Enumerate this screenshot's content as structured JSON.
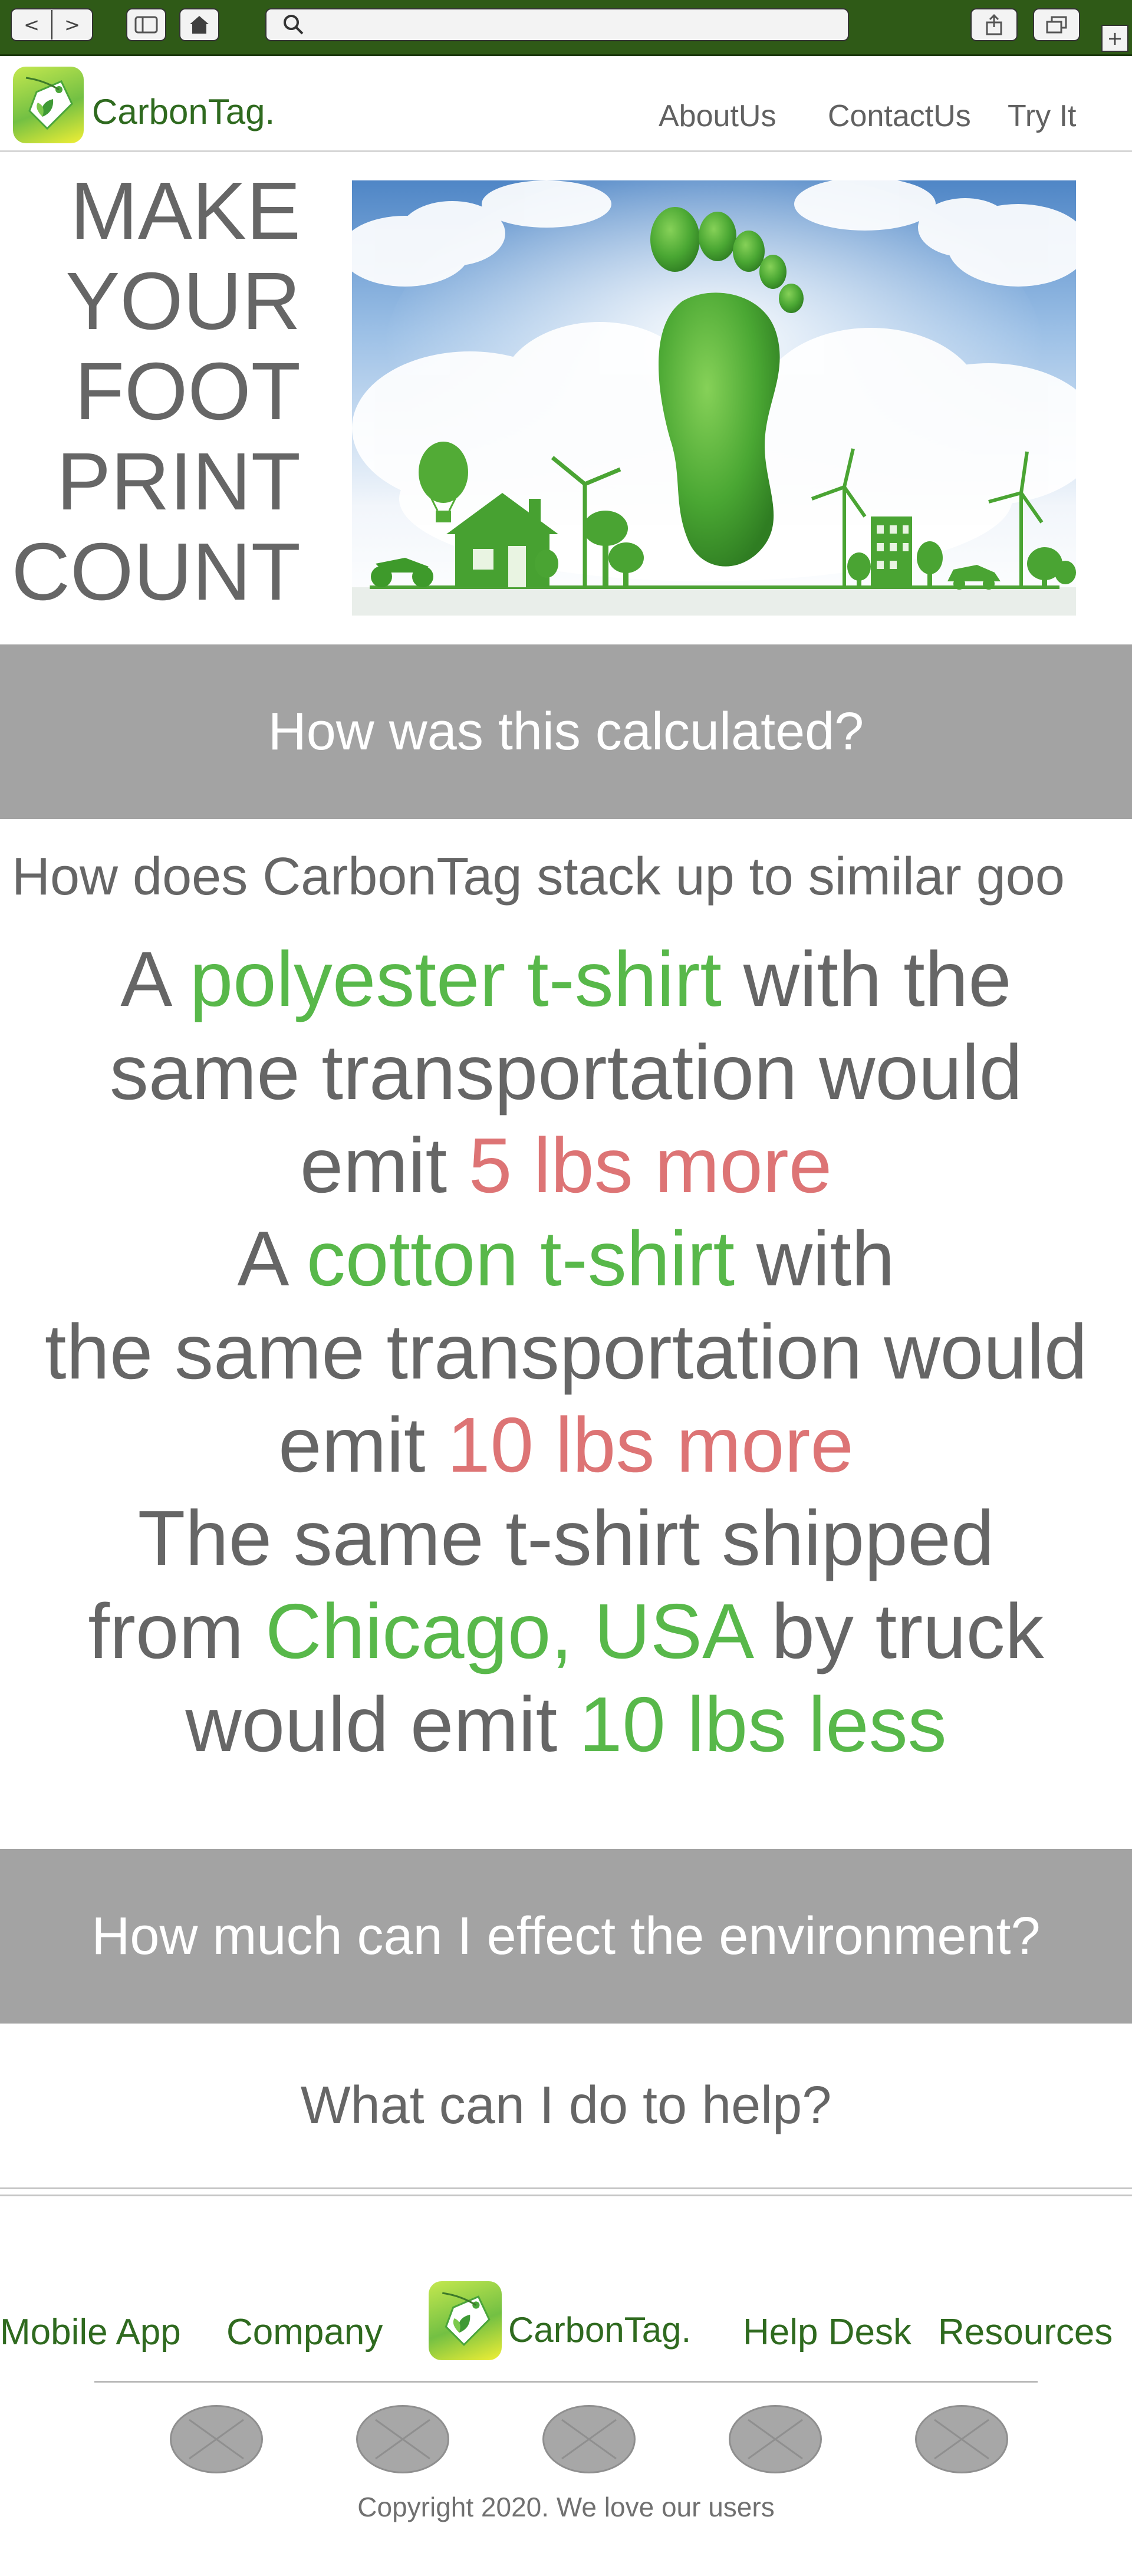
{
  "browser": {
    "back_icon": "chevron-left-icon",
    "forward_icon": "chevron-right-icon",
    "back_glyph": "<",
    "forward_glyph": ">",
    "address_placeholder": "",
    "new_tab_glyph": "+",
    "icons": [
      "sidebar-icon",
      "home-icon",
      "search-icon",
      "share-icon",
      "tabs-icon",
      "plus-icon"
    ]
  },
  "header": {
    "brand": "CarbonTag.",
    "nav": [
      "AboutUs",
      "ContactUs",
      "Try It"
    ]
  },
  "hero": {
    "words": [
      "MAKE",
      "YOUR",
      "FOOT",
      "PRINT",
      "COUNT"
    ],
    "image": "green grass footprint among clouds with wind turbines, house, trees, car, hot-air balloon"
  },
  "sections": {
    "calc_banner": "How was this calculated?",
    "compare_heading": "How does CarbonTag stack up to similar goo",
    "effect_banner": "How much can I effect the environment?",
    "help_heading": "What can I do to help?"
  },
  "comparisons": {
    "c1": {
      "p1": "A ",
      "item": "polyester t-shirt",
      "p2": " with the",
      "l2": "same transportation would",
      "p3": "emit ",
      "amount": "5 lbs more"
    },
    "c2": {
      "p1": "A ",
      "item": "cotton t-shirt",
      "p2": " with",
      "l2": "the same transportation would",
      "p3": "emit ",
      "amount": "10 lbs more"
    },
    "c3": {
      "l1": "The same t-shirt shipped",
      "p1": "from ",
      "place": "Chicago, USA",
      "p2": " by truck",
      "p3": "would emit ",
      "amount": "10 lbs less"
    }
  },
  "colors": {
    "brand_green": "#2f6a1f",
    "accent_green": "#58b84a",
    "accent_red": "#dd7475",
    "banner_gray": "#a3a3a3",
    "chrome_green": "#2f5a17"
  },
  "footer": {
    "links_left": [
      "Mobile App",
      "Company"
    ],
    "brand": "CarbonTag.",
    "links_right": [
      "Help Desk",
      "Resources"
    ],
    "social_count": 5,
    "copyright": "Copyright 2020. We love our users"
  }
}
